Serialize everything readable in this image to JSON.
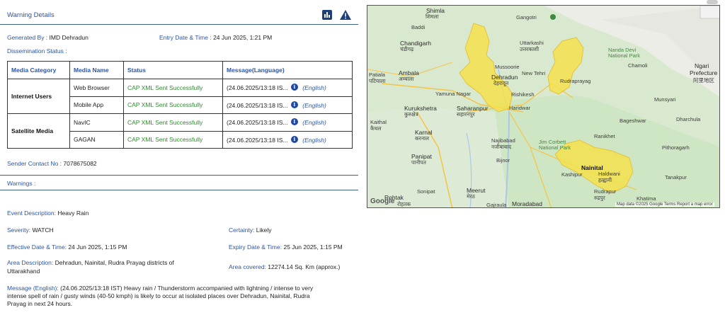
{
  "header": {
    "title": "Warning Details",
    "chart_icon": "bar-chart-icon",
    "warn_icon": "warning-triangle-icon"
  },
  "meta": {
    "generated_by_label": "Generated By :",
    "generated_by_value": "IMD Dehradun",
    "entry_label": "Entry Date & Time :",
    "entry_value": "24 Jun 2025, 1:21 PM",
    "dissemination_label": "Dissemination Status :"
  },
  "table": {
    "headers": [
      "Media Category",
      "Media Name",
      "Status",
      "Message(Language)"
    ],
    "categories": [
      "Internet Users",
      "Satellite Media"
    ],
    "rows": [
      {
        "name": "Web Browser",
        "status": "CAP XML Sent Successfully",
        "message": "(24.06.2025/13:18 IS...",
        "lang": "(English)"
      },
      {
        "name": "Mobile App",
        "status": "CAP XML Sent Successfully",
        "message": "(24.06.2025/13:18 IS...",
        "lang": "(English)"
      },
      {
        "name": "NavIC",
        "status": "CAP XML Sent Successfully",
        "message": "(24.06.2025/13:18 IS...",
        "lang": "(English)"
      },
      {
        "name": "GAGAN",
        "status": "CAP XML Sent Successfully",
        "message": "(24.06.2025/13:18 IS...",
        "lang": "(English)"
      }
    ]
  },
  "sender": {
    "label": "Sender Contact No :",
    "value": "7078675082"
  },
  "warnings_label": "Warnings :",
  "details": {
    "event_label": "Event Description:",
    "event_value": "Heavy Rain",
    "severity_label": "Severity:",
    "severity_value": "WATCH",
    "certainty_label": "Certainty:",
    "certainty_value": "Likely",
    "effective_label": "Effective Date & Time:",
    "effective_value": "24 Jun 2025, 1:15 PM",
    "expiry_label": "Expiry Date & Time:",
    "expiry_value": "25 Jun 2025, 1:15 PM",
    "area_label": "Area Description:",
    "area_value_1": "Dehradun, Nainital, Rudra Prayag districts of",
    "area_value_2": "Uttarakhand",
    "covered_label": "Area covered:",
    "covered_value": "12274.14 Sq. Km (approx.)",
    "message_label": "Message (English):",
    "message_1": "(24.06.2025/13:18 IST) Heavy rain / Thunderstorm accompanied with lightning / intense to very",
    "message_2": "intense spell of rain / gusty winds (40-50 kmph) is likely to occur at isolated places over Dehradun, Nainital, Rudra",
    "message_3": "Prayag in next 24 hours."
  },
  "map": {
    "labels": {
      "shimla": "Shimla",
      "shimla_hi": "शिमला",
      "gangotri": "Gangotri",
      "chandigarh": "Chandigarh",
      "chandigarh_hi": "चंडीगढ़",
      "uttarkashi": "Uttarkashi",
      "uttarkashi_hi": "उत्तरकाशी",
      "nanda": "Nanda Devi",
      "nanda2": "National Park",
      "ngari": "Ngari",
      "prefecture": "Prefecture",
      "prefecture_cn": "阿里地区",
      "patiala": "Patiala",
      "patiala_hi": "पटियाला",
      "ambala": "Ambala",
      "ambala_hi": "अम्बाला",
      "mussoorie": "Mussoorie",
      "dehradun": "Dehradun",
      "dehradun_hi": "देहरादून",
      "newtehri": "New Tehri",
      "rishikesh": "Rishikesh",
      "rudraprayag": "Rudraprayag",
      "chamoli": "Chamoli",
      "kurukshetra": "Kurukshetra",
      "kurukshetra_hi": "कुरुक्षेत्र",
      "saharanpur": "Saharanpur",
      "saharanpur_hi": "सहारनपुर",
      "yamuna": "Yamuna Nagar",
      "haridwar": "Haridwar",
      "kaithal": "Kaithal",
      "kaithal_hi": "कैथल",
      "karnal": "Karnal",
      "karnal_hi": "करनाल",
      "najibabad": "Najibabad",
      "najibabad_hi": "नजीबाबाद",
      "corbett": "Jim Corbett",
      "corbett2": "National Park",
      "ranikhet": "Ranikhet",
      "bageshwar": "Bageshwar",
      "munsyari": "Munsyari",
      "dharchula": "Dharchula",
      "pithoragarh": "Pithoragarh",
      "panipat": "Panipat",
      "panipat_hi": "पानीपत",
      "bijnor": "Bijnor",
      "nainital": "Nainital",
      "haldwani": "Haldwani",
      "haldwani_hi": "हल्द्वानी",
      "kashipur": "Kashipur",
      "rudrapur": "Rudrapur",
      "rudrapur_hi": "रुद्रपुर",
      "rohtak": "Rohtak",
      "rohtak_hi": "रोहतक",
      "sonipat": "Sonipat",
      "meerut": "Meerut",
      "meerut_hi": "मेरठ",
      "moradabad": "Moradabad",
      "gajraula": "Gajraula",
      "khatima": "Khatima",
      "tanakpur": "Tanakpur",
      "baddi": "Baddi"
    },
    "footer": "Map data ©2025 Google   Terms   Report a map error",
    "google": "Google",
    "colors": {
      "warning_area": "#f4e04d",
      "terrain": "#d8e8cf",
      "water": "#a9c8e8",
      "road": "#f6c343"
    }
  }
}
